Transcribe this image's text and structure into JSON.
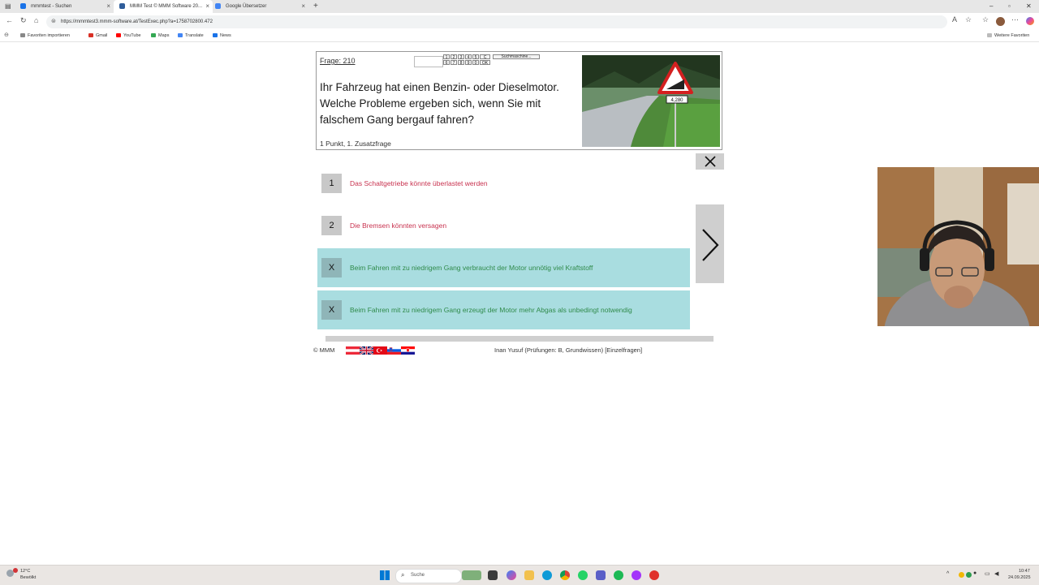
{
  "browser": {
    "tabs": [
      {
        "label": "mmmtest - Suchen",
        "color": "#1a73e8"
      },
      {
        "label": "MMM Test © MMM Software 20...",
        "color": "#2f5d9a"
      },
      {
        "label": "Google Übersetzer",
        "color": "#4285f4"
      }
    ],
    "new_tab": "+",
    "url": "https://mmmtest3.mmm-software.at/TestExec.php?a=1758702800.472",
    "favorites": [
      {
        "label": "Favoriten importieren",
        "color": "#888888"
      },
      {
        "label": "Gmail",
        "color": "#d93025"
      },
      {
        "label": "YouTube",
        "color": "#ff0000"
      },
      {
        "label": "Maps",
        "color": "#34a853"
      },
      {
        "label": "Translate",
        "color": "#4285f4"
      },
      {
        "label": "News",
        "color": "#1a73e8"
      }
    ],
    "more_favorites": "Weitere Favoriten"
  },
  "quiz": {
    "question_number": "Frage: 210",
    "keypad": [
      "1",
      "2",
      "3",
      "4",
      "5",
      "C",
      "6",
      "7",
      "8",
      "9",
      "0",
      "OK"
    ],
    "search_button": "Suchmaschine...",
    "question_text": "Ihr Fahrzeug hat einen Benzin- oder Dieselmotor. Welche Probleme ergeben sich, wenn Sie mit falschem Gang bergauf fahren?",
    "points": "1 Punkt, 1. Zusatzfrage",
    "sign_text": "4,280",
    "answers": [
      {
        "marker": "1",
        "text": "Das Schaltgetriebe könnte überlastet werden",
        "selected": false
      },
      {
        "marker": "2",
        "text": "Die Bremsen könnten versagen",
        "selected": false
      },
      {
        "marker": "X",
        "text": "Beim Fahren mit zu niedrigem Gang verbraucht der Motor unnötig viel Kraftstoff",
        "selected": true
      },
      {
        "marker": "X",
        "text": "Beim Fahren mit zu niedrigem Gang erzeugt der Motor mehr Abgas als unbedingt notwendig",
        "selected": true
      }
    ]
  },
  "footer": {
    "copyright": "© MMM",
    "user": "Inan Yusuf (Prüfungen: B, Grundwissen) [Einzelfragen]"
  },
  "taskbar": {
    "weather_temp": "12°C",
    "weather_desc": "Bewölkt",
    "search_placeholder": "Suche",
    "time": "10:47",
    "date": "24.09.2025"
  },
  "colors": {
    "wrong_answer": "#c8324f",
    "correct_answer": "#2f8a4a",
    "selected_bg": "#a9dde0"
  }
}
